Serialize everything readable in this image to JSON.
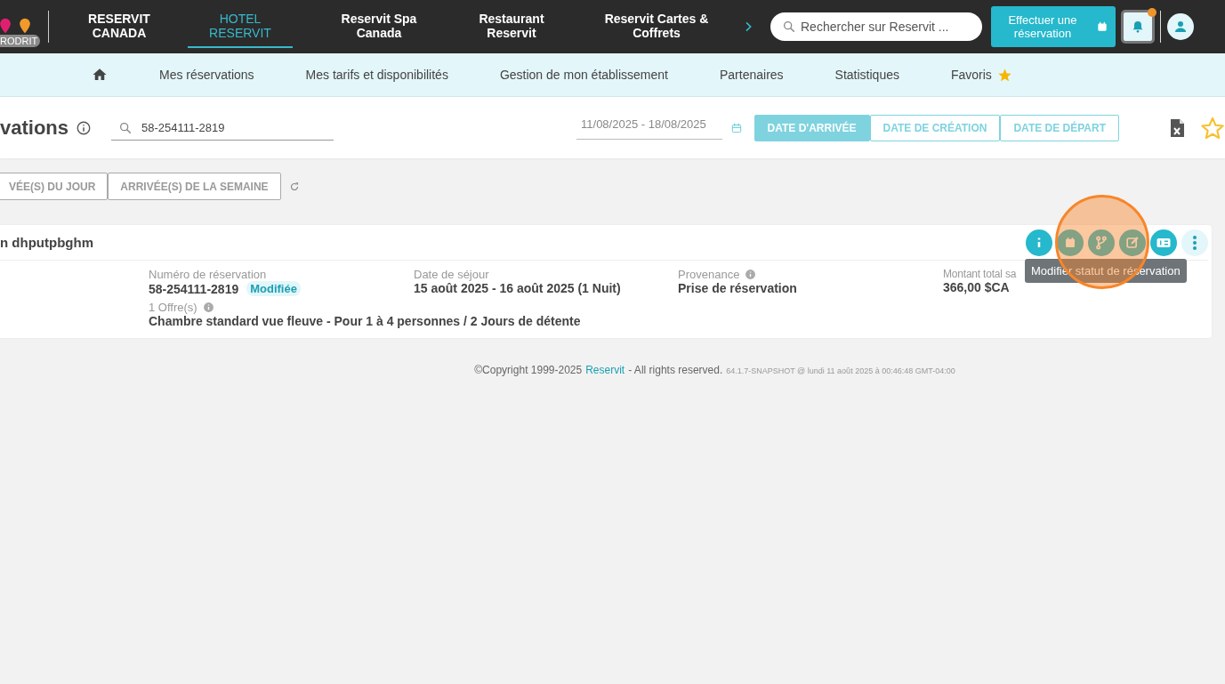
{
  "topbar": {
    "user_badge": "RODRIT",
    "tabs": [
      {
        "label": "RESERVIT CANADA",
        "selected": false
      },
      {
        "label": "HOTEL RESERVIT",
        "selected": true
      },
      {
        "label": "Reservit Spa Canada",
        "selected": false
      },
      {
        "label": "Restaurant Reservit",
        "selected": false
      },
      {
        "label": "Reservit Cartes & Coffrets",
        "selected": false
      }
    ],
    "search": {
      "placeholder": "Rechercher sur Reservit ..."
    },
    "book_button": "Effectuer une réservation",
    "notifications": {
      "unread": true
    }
  },
  "subnav": {
    "items": [
      {
        "kind": "home"
      },
      {
        "kind": "text",
        "label": "Mes réservations"
      },
      {
        "kind": "text",
        "label": "Mes tarifs et disponibilités"
      },
      {
        "kind": "text",
        "label": "Gestion de mon établissement"
      },
      {
        "kind": "text",
        "label": "Partenaires"
      },
      {
        "kind": "text",
        "label": "Statistiques"
      },
      {
        "kind": "favorites",
        "label": "Favoris"
      }
    ]
  },
  "header": {
    "title": "vations",
    "search_value": "58-254111-2819",
    "date_range": "11/08/2025 - 18/08/2025",
    "date_modes": [
      {
        "label": "DATE D'ARRIVÉE",
        "selected": true
      },
      {
        "label": "DATE DE CRÉATION",
        "selected": false
      },
      {
        "label": "DATE DE DÉPART",
        "selected": false
      }
    ],
    "favorite": false
  },
  "filters": [
    "VÉE(S) DU JOUR",
    "ARRIVÉE(S) DE LA SEMAINE"
  ],
  "reservation": {
    "name": "n dhputpbghm",
    "actions": [
      {
        "kind": "info"
      },
      {
        "kind": "calendar"
      },
      {
        "kind": "status"
      },
      {
        "kind": "edit"
      },
      {
        "kind": "payment"
      },
      {
        "kind": "more"
      }
    ],
    "tooltip": "Modifier statut de réservation",
    "fields": [
      {
        "label": "Numéro de réservation",
        "value": "58-254111-2819",
        "badge": "Modifiée"
      },
      {
        "label": "Date de séjour",
        "value": "15 août 2025 - 16 août 2025 (1 Nuit)"
      },
      {
        "label": "Provenance",
        "value": "Prise de réservation",
        "info": true
      },
      {
        "label": "Montant total sa",
        "value": "366,00 $CA"
      }
    ],
    "offer": {
      "label": "1 Offre(s)",
      "value": "Chambre standard vue fleuve - Pour 1 à 4 personnes / 2 Jours de détente",
      "info": true
    }
  },
  "footer": {
    "copyright": "©Copyright 1999-2025",
    "link": "Reservit",
    "rights": "- All rights reserved.",
    "build": "64.1.7-SNAPSHOT @ lundi 11 août 2025 à 00:46:48 GMT-04:00"
  }
}
